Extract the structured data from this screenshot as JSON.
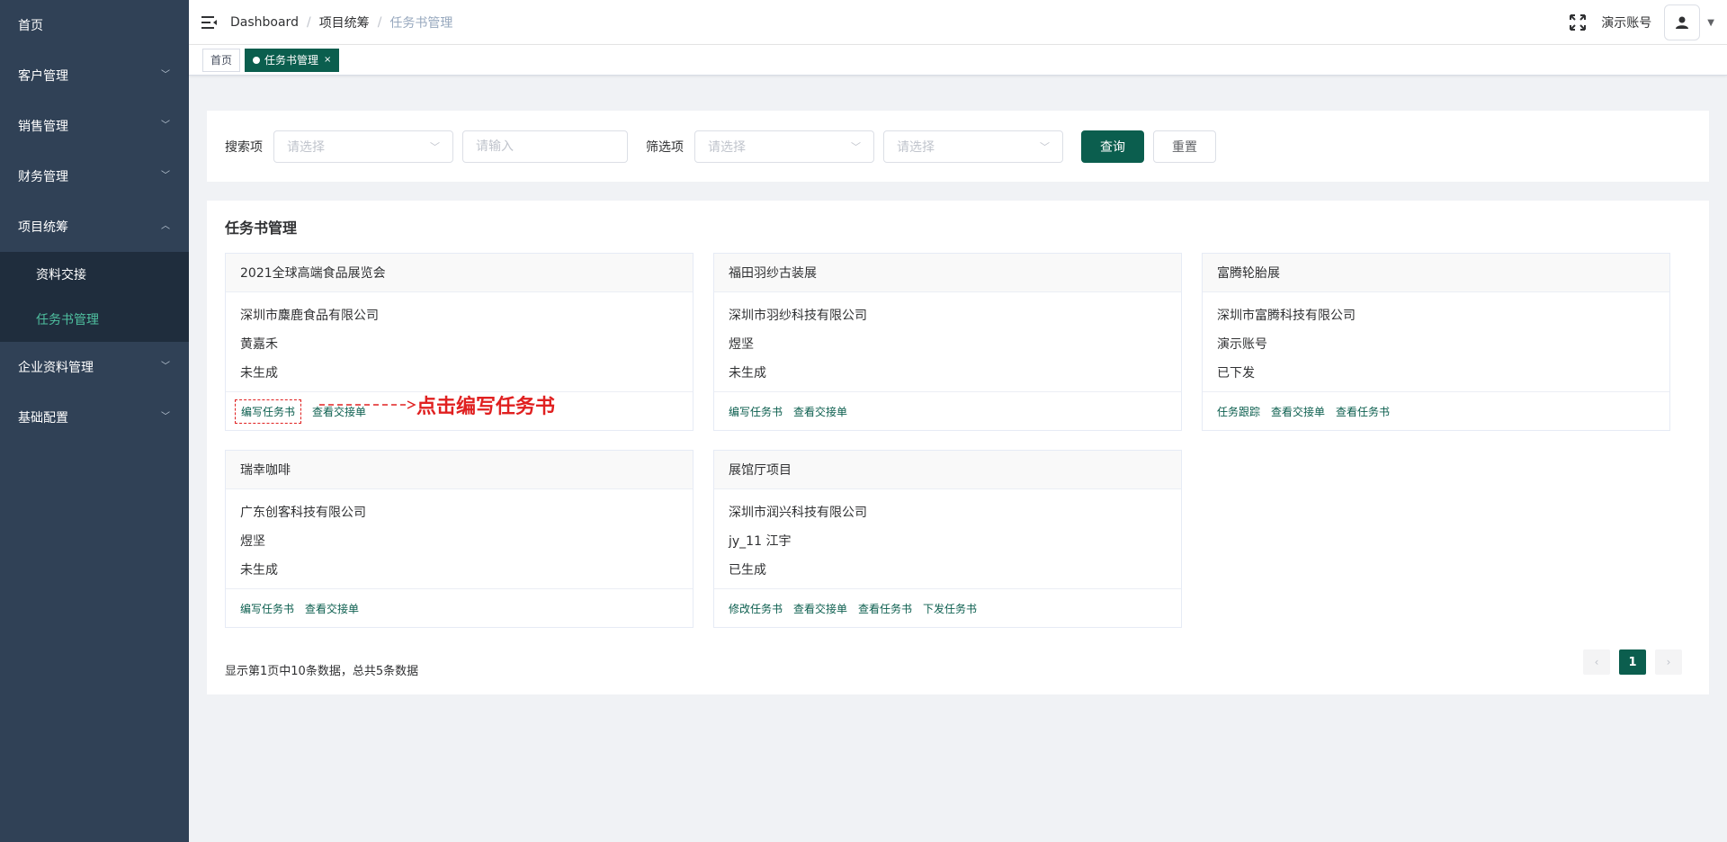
{
  "sidebar": {
    "items": [
      {
        "label": "首页",
        "has_children": false
      },
      {
        "label": "客户管理",
        "has_children": true
      },
      {
        "label": "销售管理",
        "has_children": true
      },
      {
        "label": "财务管理",
        "has_children": true
      },
      {
        "label": "项目统筹",
        "has_children": true,
        "expanded": true
      },
      {
        "label": "企业资料管理",
        "has_children": true
      },
      {
        "label": "基础配置",
        "has_children": true
      }
    ],
    "submenu": [
      {
        "label": "资料交接",
        "active": false
      },
      {
        "label": "任务书管理",
        "active": true
      }
    ]
  },
  "header": {
    "breadcrumb": [
      "Dashboard",
      "项目统筹",
      "任务书管理"
    ],
    "user_name": "演示账号"
  },
  "tags": [
    {
      "label": "首页",
      "active": false
    },
    {
      "label": "任务书管理",
      "active": true,
      "close": "×"
    }
  ],
  "search": {
    "search_label": "搜索项",
    "search_select_placeholder": "请选择",
    "search_input_placeholder": "请输入",
    "filter_label": "筛选项",
    "filter_select1_placeholder": "请选择",
    "filter_select2_placeholder": "请选择",
    "query_button": "查询",
    "reset_button": "重置"
  },
  "list": {
    "title": "任务书管理",
    "cards": [
      {
        "title": "2021全球高端食品展览会",
        "company": "深圳市麋鹿食品有限公司",
        "person": "黄嘉禾",
        "status": "未生成",
        "actions": [
          "编写任务书",
          "查看交接单"
        ]
      },
      {
        "title": "福田羽纱古装展",
        "company": "深圳市羽纱科技有限公司",
        "person": "煜坚",
        "status": "未生成",
        "actions": [
          "编写任务书",
          "查看交接单"
        ]
      },
      {
        "title": "富腾轮胎展",
        "company": "深圳市富腾科技有限公司",
        "person": "演示账号",
        "status": "已下发",
        "actions": [
          "任务跟踪",
          "查看交接单",
          "查看任务书"
        ]
      },
      {
        "title": "瑞幸咖啡",
        "company": "广东创客科技有限公司",
        "person": "煜坚",
        "status": "未生成",
        "actions": [
          "编写任务书",
          "查看交接单"
        ]
      },
      {
        "title": "展馆厅项目",
        "company": "深圳市润兴科技有限公司",
        "person": "jy_11 江宇",
        "status": "已生成",
        "actions": [
          "修改任务书",
          "查看交接单",
          "查看任务书",
          "下发任务书"
        ]
      }
    ],
    "annotation": "点击编写任务书",
    "page_info": "显示第1页中10条数据，总共5条数据",
    "current_page": "1"
  },
  "colors": {
    "primary": "#0b5e4e",
    "sidebar_bg": "#304156",
    "annotation": "#e02020"
  }
}
